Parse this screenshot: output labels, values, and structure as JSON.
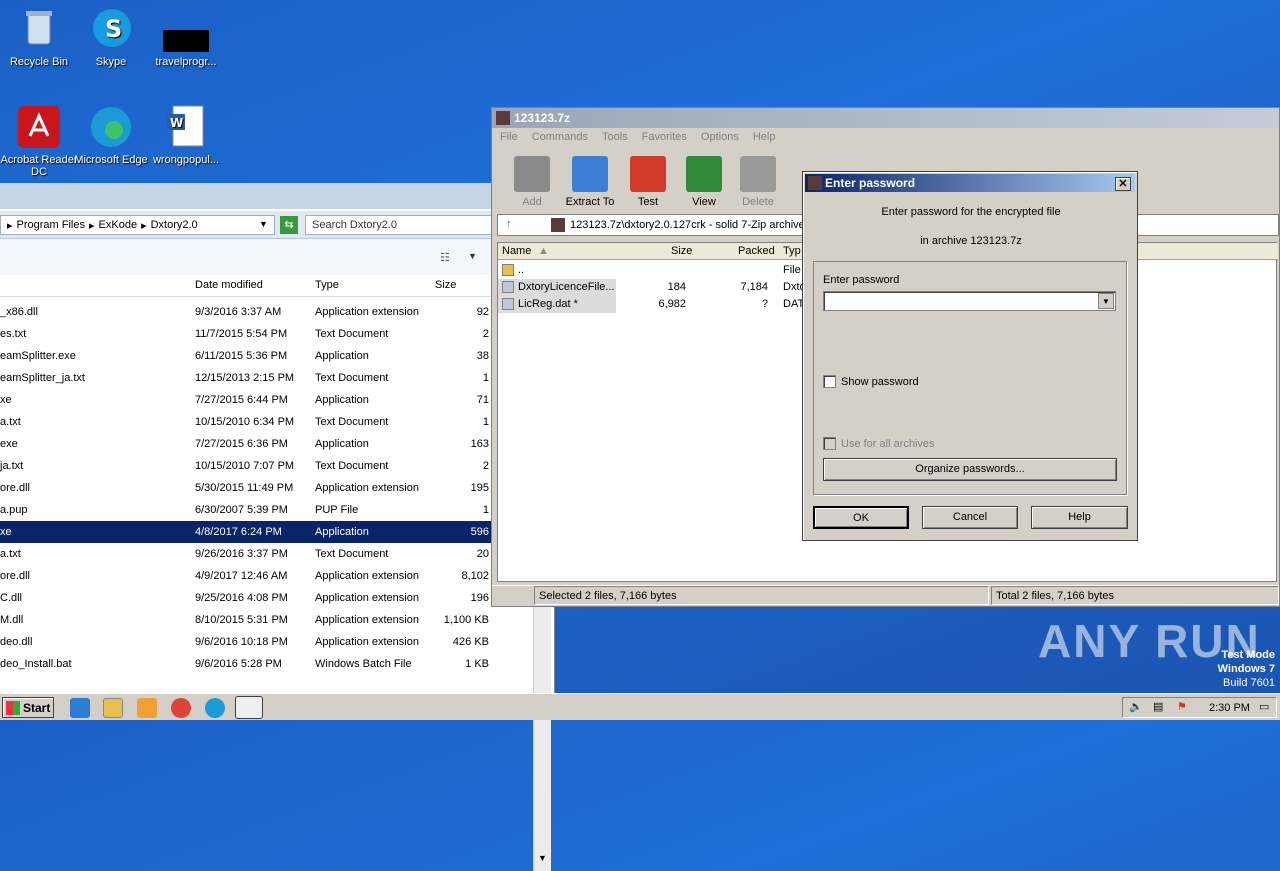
{
  "desktop": {
    "icons": [
      {
        "label": "Recycle Bin",
        "name": "recycle-bin-icon"
      },
      {
        "label": "Skype",
        "name": "skype-icon"
      },
      {
        "label": "travelprogr...",
        "name": "file-icon"
      },
      {
        "label": "Acrobat Reader DC",
        "name": "acrobat-icon"
      },
      {
        "label": "Microsoft Edge",
        "name": "edge-icon"
      },
      {
        "label": "wrongpopul...",
        "name": "word-doc-icon"
      }
    ],
    "watermark": "ANY RUN",
    "os_info": {
      "line1": "Test Mode",
      "line2": "Windows 7",
      "line3": "Build 7601"
    }
  },
  "explorer": {
    "breadcrumb": [
      "Program Files",
      "ExKode",
      "Dxtory2.0"
    ],
    "search_placeholder": "Search Dxtory2.0",
    "columns": [
      "Date modified",
      "Type",
      "Size"
    ],
    "rows": [
      {
        "name": "_x86.dll",
        "date": "9/3/2016 3:37 AM",
        "type": "Application extension",
        "size": "92"
      },
      {
        "name": "es.txt",
        "date": "11/7/2015 5:54 PM",
        "type": "Text Document",
        "size": "2"
      },
      {
        "name": "eamSplitter.exe",
        "date": "6/11/2015 5:36 PM",
        "type": "Application",
        "size": "38"
      },
      {
        "name": "eamSplitter_ja.txt",
        "date": "12/15/2013 2:15 PM",
        "type": "Text Document",
        "size": "1"
      },
      {
        "name": "xe",
        "date": "7/27/2015 6:44 PM",
        "type": "Application",
        "size": "71"
      },
      {
        "name": "a.txt",
        "date": "10/15/2010 6:34 PM",
        "type": "Text Document",
        "size": "1"
      },
      {
        "name": "exe",
        "date": "7/27/2015 6:36 PM",
        "type": "Application",
        "size": "163"
      },
      {
        "name": "ja.txt",
        "date": "10/15/2010 7:07 PM",
        "type": "Text Document",
        "size": "2"
      },
      {
        "name": "ore.dll",
        "date": "5/30/2015 11:49 PM",
        "type": "Application extension",
        "size": "195"
      },
      {
        "name": "a.pup",
        "date": "6/30/2007 5:39 PM",
        "type": "PUP File",
        "size": "1"
      },
      {
        "name": "xe",
        "date": "4/8/2017 6:24 PM",
        "type": "Application",
        "size": "596",
        "selected": true
      },
      {
        "name": "a.txt",
        "date": "9/26/2016 3:37 PM",
        "type": "Text Document",
        "size": "20"
      },
      {
        "name": "ore.dll",
        "date": "4/9/2017 12:46 AM",
        "type": "Application extension",
        "size": "8,102"
      },
      {
        "name": "C.dll",
        "date": "9/25/2016 4:08 PM",
        "type": "Application extension",
        "size": "196"
      },
      {
        "name": "M.dll",
        "date": "8/10/2015 5:31 PM",
        "type": "Application extension",
        "size": "1,100 KB"
      },
      {
        "name": "deo.dll",
        "date": "9/6/2016 10:18 PM",
        "type": "Application extension",
        "size": "426 KB"
      },
      {
        "name": "deo_Install.bat",
        "date": "9/6/2016 5:28 PM",
        "type": "Windows Batch File",
        "size": "1 KB"
      }
    ]
  },
  "zip": {
    "title": "123123.7z",
    "menu": [
      "File",
      "Commands",
      "Tools",
      "Favorites",
      "Options",
      "Help"
    ],
    "toolbar": [
      {
        "label": "Add",
        "color": "#8a8a8a"
      },
      {
        "label": "Extract To",
        "color": "#3d7fd6"
      },
      {
        "label": "Test",
        "color": "#d23a2a"
      },
      {
        "label": "View",
        "color": "#2f8a3a"
      },
      {
        "label": "Delete",
        "color": "#9a9a9a"
      }
    ],
    "path": "123123.7z\\dxtory2.0.127crk - solid 7-Zip archive",
    "columns": [
      "Name",
      "Size",
      "Packed",
      "Typ"
    ],
    "rows": [
      {
        "name": "..",
        "size": "",
        "packed": "",
        "type": "File"
      },
      {
        "name": "DxtoryLicenceFile...",
        "size": "184",
        "packed": "7,184",
        "type": "Dxto"
      },
      {
        "name": "LicReg.dat *",
        "size": "6,982",
        "packed": "?",
        "type": "DAT"
      }
    ],
    "status_left": "Selected 2 files, 7,166 bytes",
    "status_right": "Total 2 files, 7,166 bytes"
  },
  "dialog": {
    "title": "Enter password",
    "line1": "Enter password for the encrypted file",
    "line2": "in archive 123123.7z",
    "field_label": "Enter password",
    "show_password": "Show password",
    "use_for_all": "Use for all archives",
    "organize": "Organize passwords...",
    "ok": "OK",
    "cancel": "Cancel",
    "help": "Help"
  },
  "taskbar": {
    "start": "Start",
    "clock": "2:30 PM"
  }
}
